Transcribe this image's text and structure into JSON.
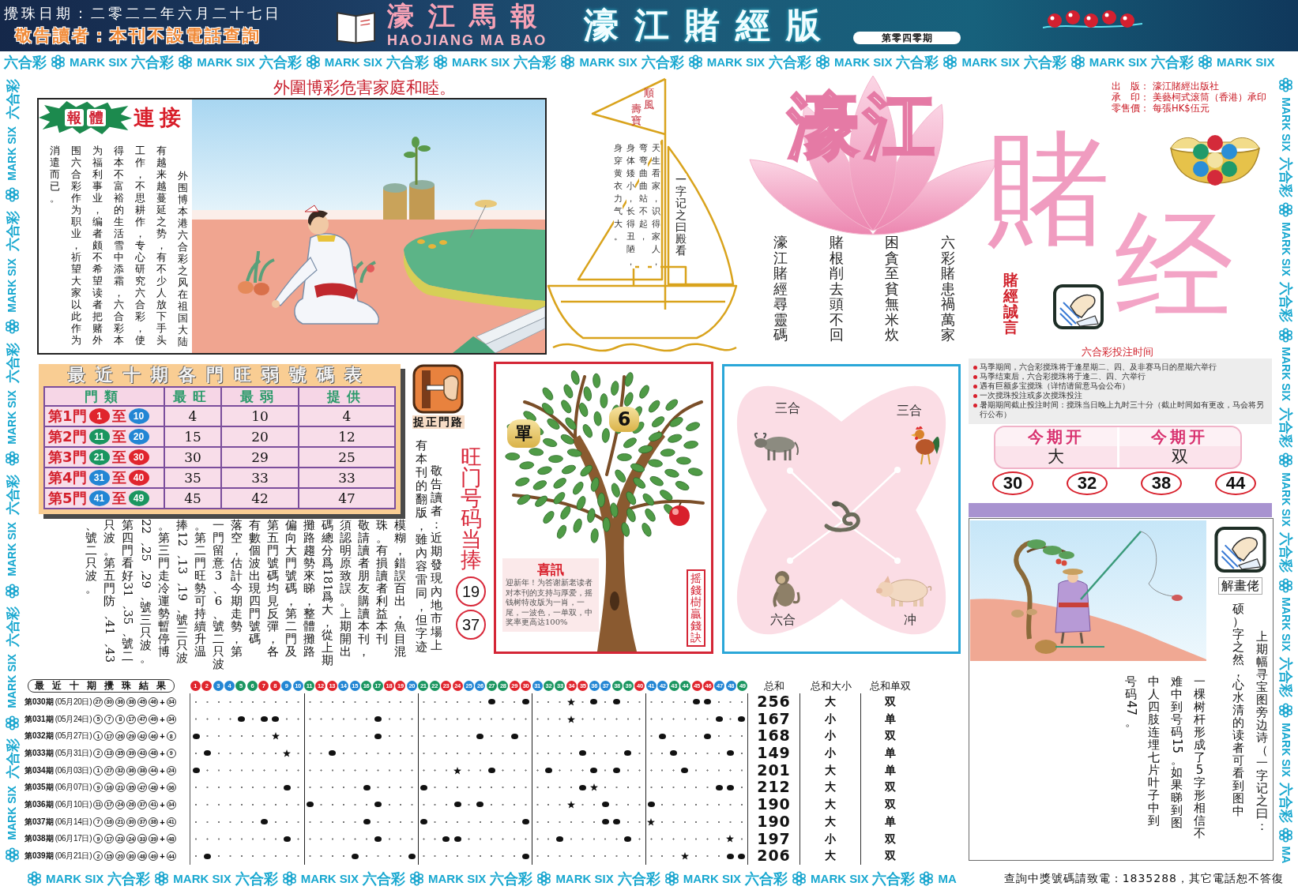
{
  "header": {
    "draw_date": "攪珠日期：二零二二年六月二十七日",
    "notice": "敬告讀者：本刊不設電話查詢",
    "paper_name": "濠江馬報",
    "paper_name_latin": "HAOJIANG MA BAO",
    "edition": "濠江賭經版",
    "issue": "第零四零期"
  },
  "border": {
    "top": [
      {
        "cn": "六合彩",
        "en": "MARK SIX"
      },
      {
        "cn": "六合彩",
        "en": "MARK SIX"
      },
      {
        "cn": "六合彩",
        "en": "MARK SIX"
      },
      {
        "cn": "六合彩",
        "en": "MARK SIX"
      },
      {
        "cn": "六合彩",
        "en": "MARK SIX"
      },
      {
        "cn": "六合彩",
        "en": "MARK SIX"
      },
      {
        "cn": "六合彩",
        "en": "MARK SIX"
      },
      {
        "cn": "六合彩",
        "en": "MARK SIX"
      },
      {
        "cn": "六合彩",
        "en": "MARK SIX"
      },
      {
        "cn": "六合彩",
        "en": "MARK SIX"
      }
    ],
    "left": [
      {
        "cn": "六合彩",
        "en": "MARK SIX"
      },
      {
        "cn": "六合彩",
        "en": "MARK SIX"
      },
      {
        "cn": "六合彩",
        "en": "MARK SIX"
      },
      {
        "cn": "六合彩",
        "en": "MARK SIX"
      },
      {
        "cn": "六合彩",
        "en": "MARK SIX"
      },
      {
        "cn": "六合彩",
        "en": "MARK SIX"
      }
    ],
    "right": [
      {
        "cn": "六合彩",
        "en": "MARK SIX"
      },
      {
        "cn": "六合彩",
        "en": "MARK SIX"
      },
      {
        "cn": "六合彩",
        "en": "MARK SIX"
      },
      {
        "cn": "六合彩",
        "en": "MARK SIX"
      },
      {
        "cn": "六合彩",
        "en": "MARK SIX"
      },
      {
        "cn": "六合彩",
        "en": "MARK SIX"
      },
      {
        "en": "MA"
      }
    ],
    "bottom": [
      {
        "cn": "六合彩",
        "en": "MARK SIX"
      },
      {
        "cn": "六合彩",
        "en": "MARK SIX"
      },
      {
        "cn": "六合彩",
        "en": "MARK SIX"
      },
      {
        "cn": "六合彩",
        "en": "MARK SIX"
      },
      {
        "cn": "六合彩",
        "en": "MARK SIX"
      },
      {
        "cn": "六合彩",
        "en": "MARK SIX"
      },
      {
        "cn": "六合彩",
        "en": "MARK SIX"
      },
      {
        "en": "MA"
      }
    ]
  },
  "headline": "外圍博彩危害家庭和睦。",
  "article": {
    "badge": [
      "報",
      "體"
    ],
    "title": "連接",
    "columns": [
      "消遣而已。",
      "围六合彩作为职业，祈望大家以此作为",
      "为福利事业，编者颇不希望读者把赌外",
      "得本不富裕的生活雪中添霜，六合彩本",
      "工作，不思耕作，专心研究六合彩，使",
      "有越来越蔓延之势，有不少人放下手头",
      "外围博本港六合彩之风在祖国大陆"
    ]
  },
  "sailboat": {
    "flag": [
      "壽寶",
      "順風"
    ],
    "heading": "一字记之曰殿看",
    "poem": [
      "身穿黄衣力气大。",
      "身体矮小，长得丑陋，",
      "弯弯曲曲站不起，",
      "天生看家，识得家人，"
    ]
  },
  "logo": {
    "lotus_text": "濠江",
    "big_chars": [
      "賭",
      "经"
    ]
  },
  "publisher": [
    {
      "label": "出　版：",
      "value": "濠江賭經出版社"
    },
    {
      "label": "承　印：",
      "value": "美藝柯式滚筒（香港）承印"
    },
    {
      "label": "零售價：",
      "value": "每張HK$伍元"
    }
  ],
  "poem": [
    "濠江賭經尋靈碼",
    "賭根削去頭不回",
    "困貪至貧無米炊",
    "六彩賭患禍萬家"
  ],
  "motto": "賭經誠言",
  "betting_times": {
    "title": "六合彩投注时间",
    "items": [
      "马季期间，六合彩搅珠将于逢星期二、四、及非赛马日的星期六举行",
      "马季结束后，六合彩搅珠将于逢二、四、六举行",
      "遇有巨额多宝搅珠（详情请留意马会公布）",
      "一次搅珠投注或多次搅珠投注",
      "暑期期间截止投注时间：搅珠当日晚上九时三十分（截止时间如有更改，马会将另行公布）"
    ]
  },
  "doors_table": {
    "title": "最近十期各門旺弱號碼表",
    "columns": [
      "門類",
      "最旺",
      "最弱",
      "提供"
    ],
    "rows": [
      {
        "door": "第1門",
        "from": {
          "label": "1",
          "color": "#e0252d"
        },
        "joiner": "至",
        "to": {
          "label": "10",
          "color": "#2386d4"
        },
        "hot": "4",
        "cold": "10",
        "pick": "4"
      },
      {
        "door": "第2門",
        "from": {
          "label": "11",
          "color": "#1a9660"
        },
        "joiner": "至",
        "to": {
          "label": "20",
          "color": "#2386d4"
        },
        "hot": "15",
        "cold": "20",
        "pick": "12"
      },
      {
        "door": "第3門",
        "from": {
          "label": "21",
          "color": "#1a9660"
        },
        "joiner": "至",
        "to": {
          "label": "30",
          "color": "#e0252d"
        },
        "hot": "30",
        "cold": "29",
        "pick": "25"
      },
      {
        "door": "第4門",
        "from": {
          "label": "31",
          "color": "#2386d4"
        },
        "joiner": "至",
        "to": {
          "label": "40",
          "color": "#e0252d"
        },
        "hot": "35",
        "cold": "33",
        "pick": "33"
      },
      {
        "door": "第5門",
        "from": {
          "label": "41",
          "color": "#2386d4"
        },
        "joiner": "至",
        "to": {
          "label": "49",
          "color": "#1a9660"
        },
        "hot": "45",
        "cold": "42",
        "pick": "47"
      }
    ]
  },
  "door_icon_label": "捉正門路",
  "notice": {
    "columns": [
      "、號二只波。",
      "只波。第五門防、41、43",
      "第四門看好31、35、號二",
      "22、25、29、號三只波。",
      "。第三門走冷運勢暫停博",
      "捧12、13、19、號三只波",
      "。第二門旺勢可持續升温",
      "一門留意3、6、號二只波",
      "落空，估計今期走勢，第",
      "有數個波出現四門號碼",
      "第五門號碼均見反彈，各",
      "偏向大門號碼，第二門及",
      "攤路趨勢來睇，整體攤路",
      "碼總分爲181爲大，從上期",
      "須認明原致誤。上期開出",
      "敬請讀者朋友購讀本刊，",
      "珠。有損讀者利益本刊",
      "模糊，錯誤百出，魚目混",
      "有本刊的翻版，雖內容雷同，但字迹",
      "敬告讀者：近期發現內地市場上"
    ]
  },
  "hot_pick": {
    "title": "旺门号码当捧",
    "numbers": [
      "19",
      "37"
    ]
  },
  "money_tree": {
    "tags": [
      "單",
      "6"
    ],
    "card_title": "喜訊",
    "card_text": "迎新年！为答谢新老读者对本刊的支持与厚爱，摇钱树特改版为一肖，一尾，一波色，一单双，中奖率更高达100%",
    "label": "摇錢樹贏錢訣"
  },
  "zodiac": {
    "labels": [
      "三合",
      "三合",
      "六合",
      "冲"
    ]
  },
  "this_issue": [
    {
      "heading": "今期开",
      "value": "大"
    },
    {
      "heading": "今期开",
      "value": "双"
    }
  ],
  "picks": [
    "30",
    "32",
    "38",
    "44"
  ],
  "riddle": {
    "label": "解畫佬",
    "columns": [
      "号码47。",
      "中人四肢连埋七片叶子中到",
      "难中到号码15。如果睇到图",
      "一棵树杆形成了5字形相信不",
      "硕）字之然，心水清的读者可看到图中",
      "上期幅寻宝图旁边诗（一字记之曰："
    ]
  },
  "results": {
    "title": "最近十期攪珠結果",
    "numbers": [
      {
        "label": "1",
        "color": "#e0252d"
      },
      {
        "label": "2",
        "color": "#e0252d"
      },
      {
        "label": "3",
        "color": "#2386d4"
      },
      {
        "label": "4",
        "color": "#2386d4"
      },
      {
        "label": "5",
        "color": "#1a9660"
      },
      {
        "label": "6",
        "color": "#1a9660"
      },
      {
        "label": "7",
        "color": "#e0252d"
      },
      {
        "label": "8",
        "color": "#e0252d"
      },
      {
        "label": "9",
        "color": "#2386d4"
      },
      {
        "label": "10",
        "color": "#2386d4"
      },
      {
        "label": "11",
        "color": "#1a9660"
      },
      {
        "label": "12",
        "color": "#e0252d"
      },
      {
        "label": "13",
        "color": "#e0252d"
      },
      {
        "label": "14",
        "color": "#2386d4"
      },
      {
        "label": "15",
        "color": "#2386d4"
      },
      {
        "label": "16",
        "color": "#1a9660"
      },
      {
        "label": "17",
        "color": "#1a9660"
      },
      {
        "label": "18",
        "color": "#e0252d"
      },
      {
        "label": "19",
        "color": "#e0252d"
      },
      {
        "label": "20",
        "color": "#2386d4"
      },
      {
        "label": "21",
        "color": "#1a9660"
      },
      {
        "label": "22",
        "color": "#1a9660"
      },
      {
        "label": "23",
        "color": "#e0252d"
      },
      {
        "label": "24",
        "color": "#e0252d"
      },
      {
        "label": "25",
        "color": "#2386d4"
      },
      {
        "label": "26",
        "color": "#2386d4"
      },
      {
        "label": "27",
        "color": "#1a9660"
      },
      {
        "label": "28",
        "color": "#1a9660"
      },
      {
        "label": "29",
        "color": "#e0252d"
      },
      {
        "label": "30",
        "color": "#e0252d"
      },
      {
        "label": "31",
        "color": "#2386d4"
      },
      {
        "label": "32",
        "color": "#1a9660"
      },
      {
        "label": "33",
        "color": "#1a9660"
      },
      {
        "label": "34",
        "color": "#e0252d"
      },
      {
        "label": "35",
        "color": "#e0252d"
      },
      {
        "label": "36",
        "color": "#2386d4"
      },
      {
        "label": "37",
        "color": "#2386d4"
      },
      {
        "label": "38",
        "color": "#1a9660"
      },
      {
        "label": "39",
        "color": "#1a9660"
      },
      {
        "label": "40",
        "color": "#e0252d"
      },
      {
        "label": "41",
        "color": "#2386d4"
      },
      {
        "label": "42",
        "color": "#2386d4"
      },
      {
        "label": "43",
        "color": "#1a9660"
      },
      {
        "label": "44",
        "color": "#1a9660"
      },
      {
        "label": "45",
        "color": "#e0252d"
      },
      {
        "label": "46",
        "color": "#e0252d"
      },
      {
        "label": "47",
        "color": "#2386d4"
      },
      {
        "label": "48",
        "color": "#2386d4"
      },
      {
        "label": "49",
        "color": "#1a9660"
      }
    ],
    "sum_headers": [
      "总和",
      "总和大小",
      "总和单双"
    ],
    "rows": [
      {
        "period": "第030期",
        "date": "(05月20日)",
        "balls": [
          "27",
          "30",
          "36",
          "38",
          "45",
          "46"
        ],
        "plus": "+",
        "special": "34",
        "sum": "256",
        "size": "大",
        "parity": "双"
      },
      {
        "period": "第031期",
        "date": "(05月24日)",
        "balls": [
          "5",
          "7",
          "8",
          "17",
          "47",
          "49"
        ],
        "plus": "+",
        "special": "34",
        "sum": "167",
        "size": "小",
        "parity": "单"
      },
      {
        "period": "第032期",
        "date": "(05月27日)",
        "balls": [
          "1",
          "17",
          "26",
          "29",
          "42",
          "46"
        ],
        "plus": "+",
        "special": "8",
        "sum": "168",
        "size": "小",
        "parity": "双"
      },
      {
        "period": "第033期",
        "date": "(05月31日)",
        "balls": [
          "2",
          "13",
          "35",
          "39",
          "43",
          "48"
        ],
        "plus": "+",
        "special": "9",
        "sum": "149",
        "size": "小",
        "parity": "单"
      },
      {
        "period": "第034期",
        "date": "(06月03日)",
        "balls": [
          "1",
          "27",
          "32",
          "36",
          "38",
          "44"
        ],
        "plus": "+",
        "special": "24",
        "sum": "201",
        "size": "大",
        "parity": "单"
      },
      {
        "period": "第035期",
        "date": "(06月07日)",
        "balls": [
          "9",
          "16",
          "21",
          "35",
          "47",
          "48"
        ],
        "plus": "+",
        "special": "36",
        "sum": "212",
        "size": "大",
        "parity": "双"
      },
      {
        "period": "第036期",
        "date": "(06月10日)",
        "balls": [
          "11",
          "17",
          "24",
          "26",
          "37",
          "41"
        ],
        "plus": "+",
        "special": "34",
        "sum": "190",
        "size": "大",
        "parity": "双"
      },
      {
        "period": "第037期",
        "date": "(06月14日)",
        "balls": [
          "7",
          "16",
          "21",
          "30",
          "37",
          "38"
        ],
        "plus": "+",
        "special": "41",
        "sum": "190",
        "size": "大",
        "parity": "单"
      },
      {
        "period": "第038期",
        "date": "(06月17日)",
        "balls": [
          "9",
          "17",
          "23",
          "24",
          "33",
          "39"
        ],
        "plus": "+",
        "special": "48",
        "sum": "197",
        "size": "小",
        "parity": "双"
      },
      {
        "period": "第039期",
        "date": "(06月21日)",
        "balls": [
          "2",
          "15",
          "20",
          "30",
          "48",
          "49"
        ],
        "plus": "+",
        "special": "44",
        "sum": "206",
        "size": "大",
        "parity": "双"
      }
    ]
  },
  "footer": "查詢中獎號碼請致電：1835288，其它電話恕不答復"
}
